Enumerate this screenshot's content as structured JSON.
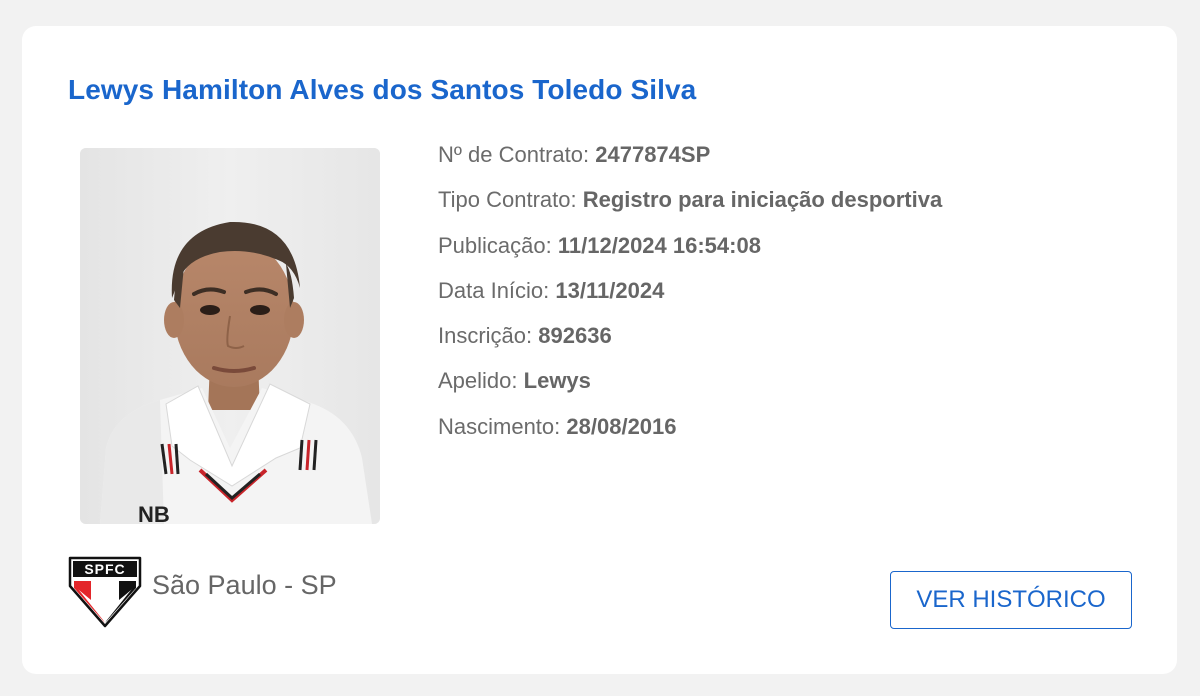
{
  "player": {
    "name": "Lewys Hamilton Alves dos Santos Toledo Silva",
    "photo_alt": "player-photo"
  },
  "details": [
    {
      "label": "Nº de Contrato:",
      "value": "2477874SP"
    },
    {
      "label": "Tipo Contrato:",
      "value": "Registro para iniciação desportiva"
    },
    {
      "label": "Publicação:",
      "value": "11/12/2024 16:54:08"
    },
    {
      "label": "Data Início:",
      "value": "13/11/2024"
    },
    {
      "label": "Inscrição:",
      "value": "892636"
    },
    {
      "label": "Apelido:",
      "value": "Lewys"
    },
    {
      "label": "Nascimento:",
      "value": "28/08/2016"
    }
  ],
  "club": {
    "crest_text": "SPFC",
    "name": "São Paulo - SP",
    "crest_icon": "spfc-crest-icon"
  },
  "actions": {
    "history_label": "VER HISTÓRICO"
  },
  "colors": {
    "accent": "#1a66cc",
    "text": "#666666",
    "background": "#f2f2f2",
    "card": "#ffffff",
    "crest_red": "#e3262a",
    "crest_black": "#111111"
  }
}
